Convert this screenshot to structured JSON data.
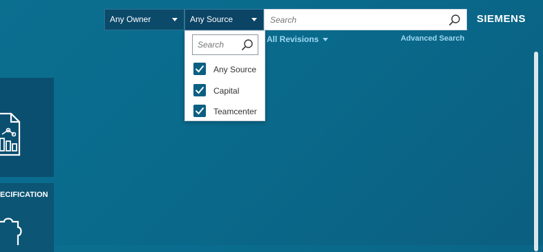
{
  "header": {
    "owner_filter": "Any Owner",
    "source_filter": "Any Source",
    "search_placeholder": "Search",
    "brand": "SIEMENS",
    "revisions_filter": "All Revisions",
    "advanced_search": "Advanced Search"
  },
  "source_dropdown": {
    "search_placeholder": "Search",
    "options": [
      {
        "label": "Any Source",
        "checked": true
      },
      {
        "label": "Capital",
        "checked": true
      },
      {
        "label": "Teamcenter",
        "checked": true
      }
    ]
  },
  "tiles": [
    {
      "label": "",
      "icon": "document-chart-icon"
    },
    {
      "label": "ECIFICATION",
      "icon": "puzzle-icon"
    }
  ],
  "colors": {
    "background": "#0a6a8c",
    "dropdown_bg": "#0c4a6a",
    "checkbox": "#0b5f82",
    "link": "#9fd9f2"
  }
}
